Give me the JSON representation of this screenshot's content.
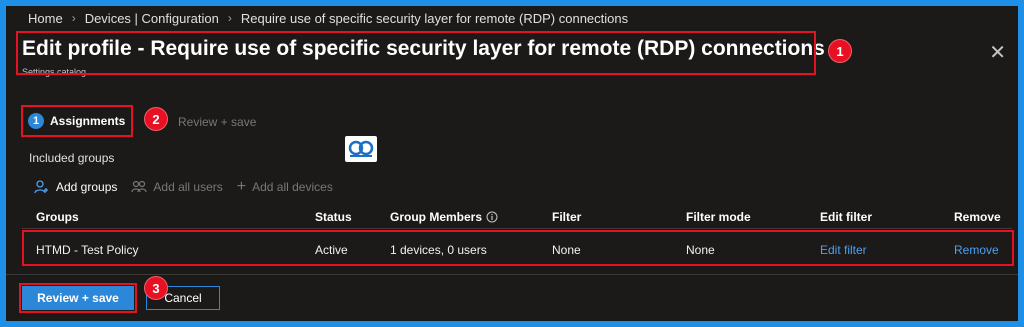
{
  "breadcrumb": [
    "Home",
    "Devices | Configuration",
    "Require use of specific security layer for remote (RDP) connections"
  ],
  "title": "Edit profile - Require use of specific security layer for remote (RDP) connections",
  "subtitle": "Settings catalog",
  "badges": [
    "1",
    "2",
    "3"
  ],
  "steps": [
    {
      "number": "1",
      "label": "Assignments",
      "state": "active"
    },
    {
      "label": "Review + save",
      "state": "disabled"
    }
  ],
  "included_groups_label": "Included groups",
  "actions": [
    {
      "label": "Add groups",
      "icon": "person-add-icon",
      "enabled": true
    },
    {
      "label": "Add all users",
      "icon": "people-icon",
      "enabled": false
    },
    {
      "label": "Add all devices",
      "icon": "plus-icon",
      "enabled": false
    }
  ],
  "table": {
    "columns": [
      "Groups",
      "Status",
      "Group Members",
      "Filter",
      "Filter mode",
      "Edit filter",
      "Remove"
    ],
    "rows": [
      {
        "group": "HTMD - Test Policy",
        "status": "Active",
        "members": "1 devices, 0 users",
        "filter": "None",
        "filter_mode": "None",
        "edit_filter": "Edit filter",
        "remove": "Remove"
      }
    ]
  },
  "buttons": {
    "review": "Review + save",
    "cancel": "Cancel"
  },
  "colors": {
    "accent": "#2b88d8",
    "highlight": "#e81123",
    "frame": "#1e90e8",
    "background": "#1b1a19"
  }
}
